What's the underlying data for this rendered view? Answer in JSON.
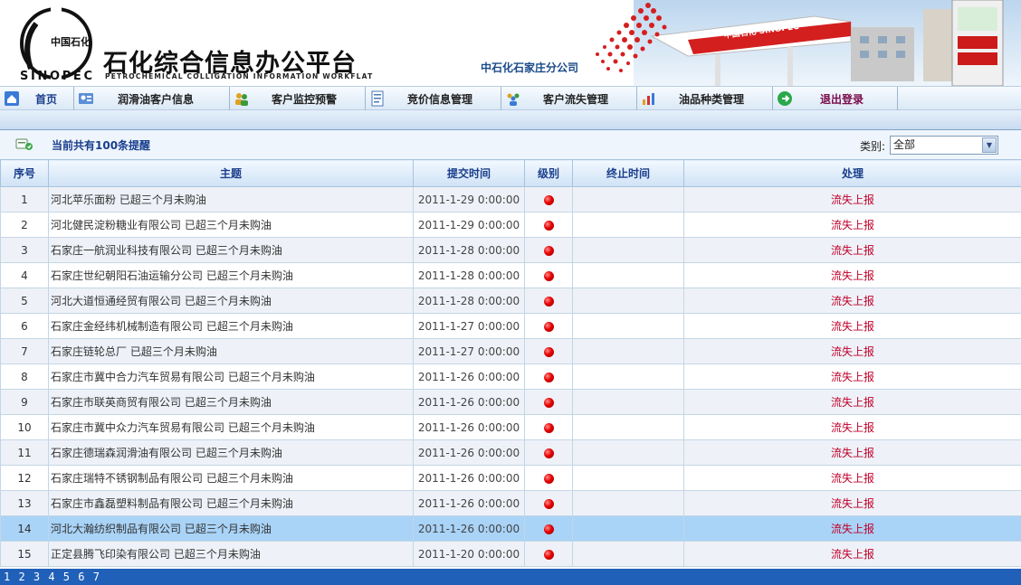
{
  "header": {
    "logo_text_cn": "中国石化",
    "logo_word": "SINOPEC",
    "system_title": "石化综合信息办公平台",
    "system_subtitle": "PETROCHEMICAL COLLIGATION INFORMATION WORKFLAT",
    "branch_name": "中石化石家庄分公司",
    "station_sign": "中国石化 SINOPEC"
  },
  "nav": {
    "items": [
      {
        "label": "首页",
        "icon": "home-icon"
      },
      {
        "label": "润滑油客户信息",
        "icon": "customer-card-icon"
      },
      {
        "label": "客户监控预警",
        "icon": "users-monitor-icon"
      },
      {
        "label": "竞价信息管理",
        "icon": "document-icon"
      },
      {
        "label": "客户流失管理",
        "icon": "users-group-icon"
      },
      {
        "label": "油品种类管理",
        "icon": "chart-icon"
      },
      {
        "label": "退出登录",
        "icon": "logout-icon"
      }
    ]
  },
  "toolbar": {
    "count_text": "当前共有100条提醒",
    "category_label": "类别:",
    "category_value": "全部"
  },
  "table": {
    "headers": [
      "序号",
      "主题",
      "提交时间",
      "级别",
      "终止时间",
      "处理"
    ],
    "rows": [
      {
        "no": "1",
        "topic": "河北苹乐面粉  已超三个月未购油",
        "time": "2011-1-29 0:00:00",
        "action": "流失上报"
      },
      {
        "no": "2",
        "topic": "河北健民淀粉糖业有限公司  已超三个月未购油",
        "time": "2011-1-29 0:00:00",
        "action": "流失上报"
      },
      {
        "no": "3",
        "topic": "石家庄一航润业科技有限公司  已超三个月未购油",
        "time": "2011-1-28 0:00:00",
        "action": "流失上报"
      },
      {
        "no": "4",
        "topic": "石家庄世纪朝阳石油运输分公司  已超三个月未购油",
        "time": "2011-1-28 0:00:00",
        "action": "流失上报"
      },
      {
        "no": "5",
        "topic": "河北大道恒通经贸有限公司  已超三个月未购油",
        "time": "2011-1-28 0:00:00",
        "action": "流失上报"
      },
      {
        "no": "6",
        "topic": "石家庄金经纬机械制造有限公司  已超三个月未购油",
        "time": "2011-1-27 0:00:00",
        "action": "流失上报"
      },
      {
        "no": "7",
        "topic": "石家庄链轮总厂  已超三个月未购油",
        "time": "2011-1-27 0:00:00",
        "action": "流失上报"
      },
      {
        "no": "8",
        "topic": "石家庄市冀中合力汽车贸易有限公司  已超三个月未购油",
        "time": "2011-1-26 0:00:00",
        "action": "流失上报"
      },
      {
        "no": "9",
        "topic": "石家庄市联英商贸有限公司  已超三个月未购油",
        "time": "2011-1-26 0:00:00",
        "action": "流失上报"
      },
      {
        "no": "10",
        "topic": "石家庄市冀中众力汽车贸易有限公司  已超三个月未购油",
        "time": "2011-1-26 0:00:00",
        "action": "流失上报"
      },
      {
        "no": "11",
        "topic": "石家庄德瑞森润滑油有限公司  已超三个月未购油",
        "time": "2011-1-26 0:00:00",
        "action": "流失上报"
      },
      {
        "no": "12",
        "topic": "石家庄瑞特不锈钢制品有限公司  已超三个月未购油",
        "time": "2011-1-26 0:00:00",
        "action": "流失上报"
      },
      {
        "no": "13",
        "topic": "石家庄市鑫磊塑料制品有限公司  已超三个月未购油",
        "time": "2011-1-26 0:00:00",
        "action": "流失上报"
      },
      {
        "no": "14",
        "topic": "河北大瀚纺织制品有限公司  已超三个月未购油",
        "time": "2011-1-26 0:00:00",
        "action": "流失上报"
      },
      {
        "no": "15",
        "topic": "正定县腾飞印染有限公司  已超三个月未购油",
        "time": "2011-1-20 0:00:00",
        "action": "流失上报"
      }
    ],
    "selected_index": 13
  },
  "statusbar": {
    "text": "1 2 3 4 5 6 7"
  },
  "colors": {
    "accent": "#1a3e8c",
    "alert": "#e60000",
    "action": "#c0002a",
    "statusbar": "#2060b8"
  }
}
